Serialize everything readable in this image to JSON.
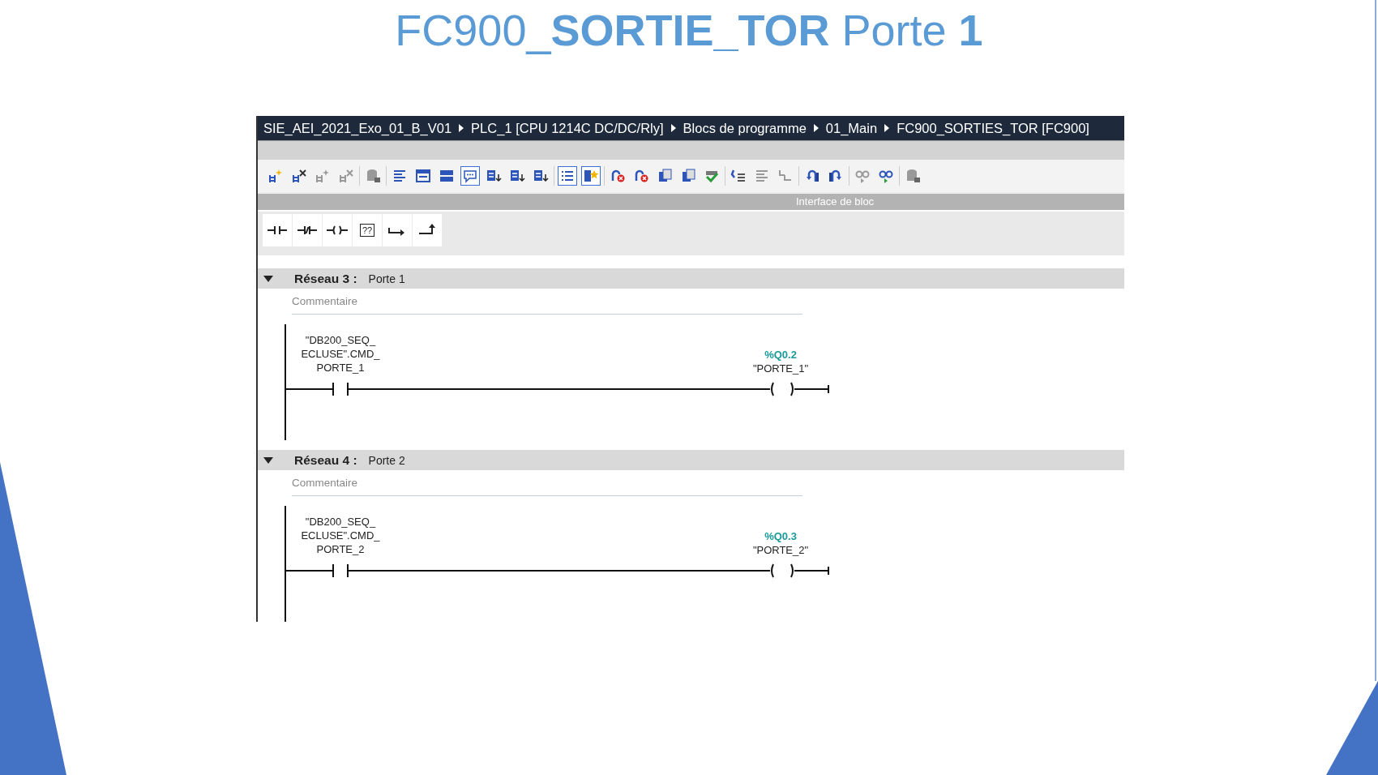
{
  "slide_title": "FC900_**SORTIE_TOR** Porte **1**",
  "editor": {
    "breadcrumb": [
      "SIE_AEI_2021_Exo_01_B_V01",
      "PLC_1 [CPU 1214C DC/DC/Rly]",
      "Blocs de programme",
      "01_Main",
      "FC900_SORTIES_TOR [FC900]"
    ],
    "toolbar": [
      [
        {
          "kind": "insert",
          "disabled": false,
          "selected": false
        },
        {
          "kind": "remove",
          "disabled": false,
          "selected": false
        },
        {
          "kind": "insert",
          "disabled": true,
          "selected": false
        },
        {
          "kind": "remove",
          "disabled": true,
          "selected": false
        }
      ],
      [
        {
          "kind": "database",
          "disabled": true,
          "selected": false
        }
      ],
      [
        {
          "kind": "lines",
          "disabled": false,
          "selected": false
        },
        {
          "kind": "window",
          "disabled": false,
          "selected": false
        },
        {
          "kind": "bar",
          "disabled": false,
          "selected": false
        },
        {
          "kind": "comment",
          "disabled": false,
          "selected": true
        },
        {
          "kind": "download",
          "disabled": false,
          "selected": false
        },
        {
          "kind": "download",
          "disabled": false,
          "selected": false
        },
        {
          "kind": "download",
          "disabled": false,
          "selected": false
        }
      ],
      [
        {
          "kind": "list",
          "disabled": false,
          "selected": true
        },
        {
          "kind": "star",
          "disabled": false,
          "selected": true
        }
      ],
      [
        {
          "kind": "jump_error",
          "disabled": false,
          "selected": false
        },
        {
          "kind": "jump_error",
          "disabled": false,
          "selected": false
        },
        {
          "kind": "doc",
          "disabled": false,
          "selected": false
        },
        {
          "kind": "doc",
          "disabled": false,
          "selected": false
        },
        {
          "kind": "check",
          "disabled": false,
          "selected": false
        }
      ],
      [
        {
          "kind": "indent",
          "disabled": false,
          "selected": false
        },
        {
          "kind": "lines",
          "disabled": true,
          "selected": false
        },
        {
          "kind": "tree",
          "disabled": true,
          "selected": false
        }
      ],
      [
        {
          "kind": "arrow_left",
          "disabled": false,
          "selected": false
        },
        {
          "kind": "arrow_right",
          "disabled": false,
          "selected": false
        }
      ],
      [
        {
          "kind": "glasses",
          "disabled": true,
          "selected": false
        },
        {
          "kind": "glasses",
          "disabled": false,
          "selected": false
        }
      ],
      [
        {
          "kind": "database",
          "disabled": true,
          "selected": false
        }
      ]
    ],
    "interface_label": "Interface de bloc",
    "palette": [
      {
        "kind": "no_contact"
      },
      {
        "kind": "nc_contact"
      },
      {
        "kind": "coil"
      },
      {
        "kind": "box",
        "text": "??"
      },
      {
        "kind": "open_branch"
      },
      {
        "kind": "close_branch"
      }
    ],
    "networks": [
      {
        "title": "Réseau 3 :",
        "name": "Porte 1",
        "expanded": true,
        "comment": {
          "placeholder": "Commentaire"
        },
        "contact": {
          "operand": [
            "\"DB200_SEQ_",
            "ECLUSE\".CMD_",
            "PORTE_1"
          ]
        },
        "coil": {
          "address": "%Q0.2",
          "tag": "\"PORTE_1\""
        }
      },
      {
        "title": "Réseau 4 :",
        "name": "Porte 2",
        "expanded": true,
        "comment": {
          "placeholder": "Commentaire"
        },
        "contact": {
          "operand": [
            "\"DB200_SEQ_",
            "ECLUSE\".CMD_",
            "PORTE_2"
          ]
        },
        "coil": {
          "address": "%Q0.3",
          "tag": "\"PORTE_2\""
        }
      }
    ]
  }
}
